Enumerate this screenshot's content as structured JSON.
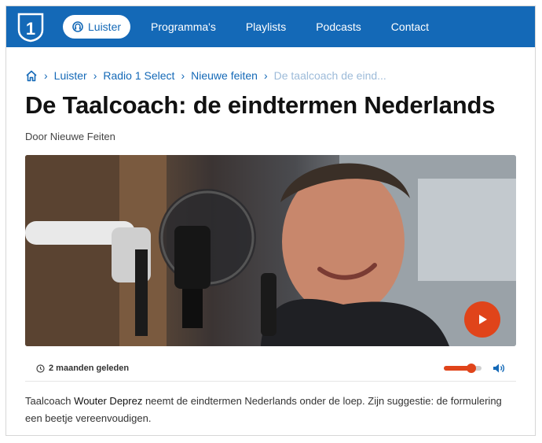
{
  "header": {
    "logo_text": "1",
    "listen_button": "Luister",
    "nav": [
      "Programma's",
      "Playlists",
      "Podcasts",
      "Contact"
    ]
  },
  "breadcrumb": {
    "items": [
      "Luister",
      "Radio 1 Select",
      "Nieuwe feiten"
    ],
    "current": "De taalcoach de eind..."
  },
  "article": {
    "title": "De Taalcoach: de eindtermen Nederlands",
    "byline": "Door Nieuwe Feiten",
    "time_ago": "2 maanden geleden",
    "volume_level": 0.72,
    "description_pre": "Taalcoach ",
    "description_name": "Wouter Deprez",
    "description_post": " neemt de eindtermen Nederlands onder de loep. Zijn suggestie: de formulering een beetje vereenvoudigen."
  },
  "colors": {
    "brand_blue": "#1469b7",
    "accent_orange": "#e0441a"
  },
  "icons": {
    "home": "home-icon",
    "listen": "headphones-icon",
    "clock": "clock-icon",
    "volume": "speaker-icon",
    "play": "play-icon"
  }
}
